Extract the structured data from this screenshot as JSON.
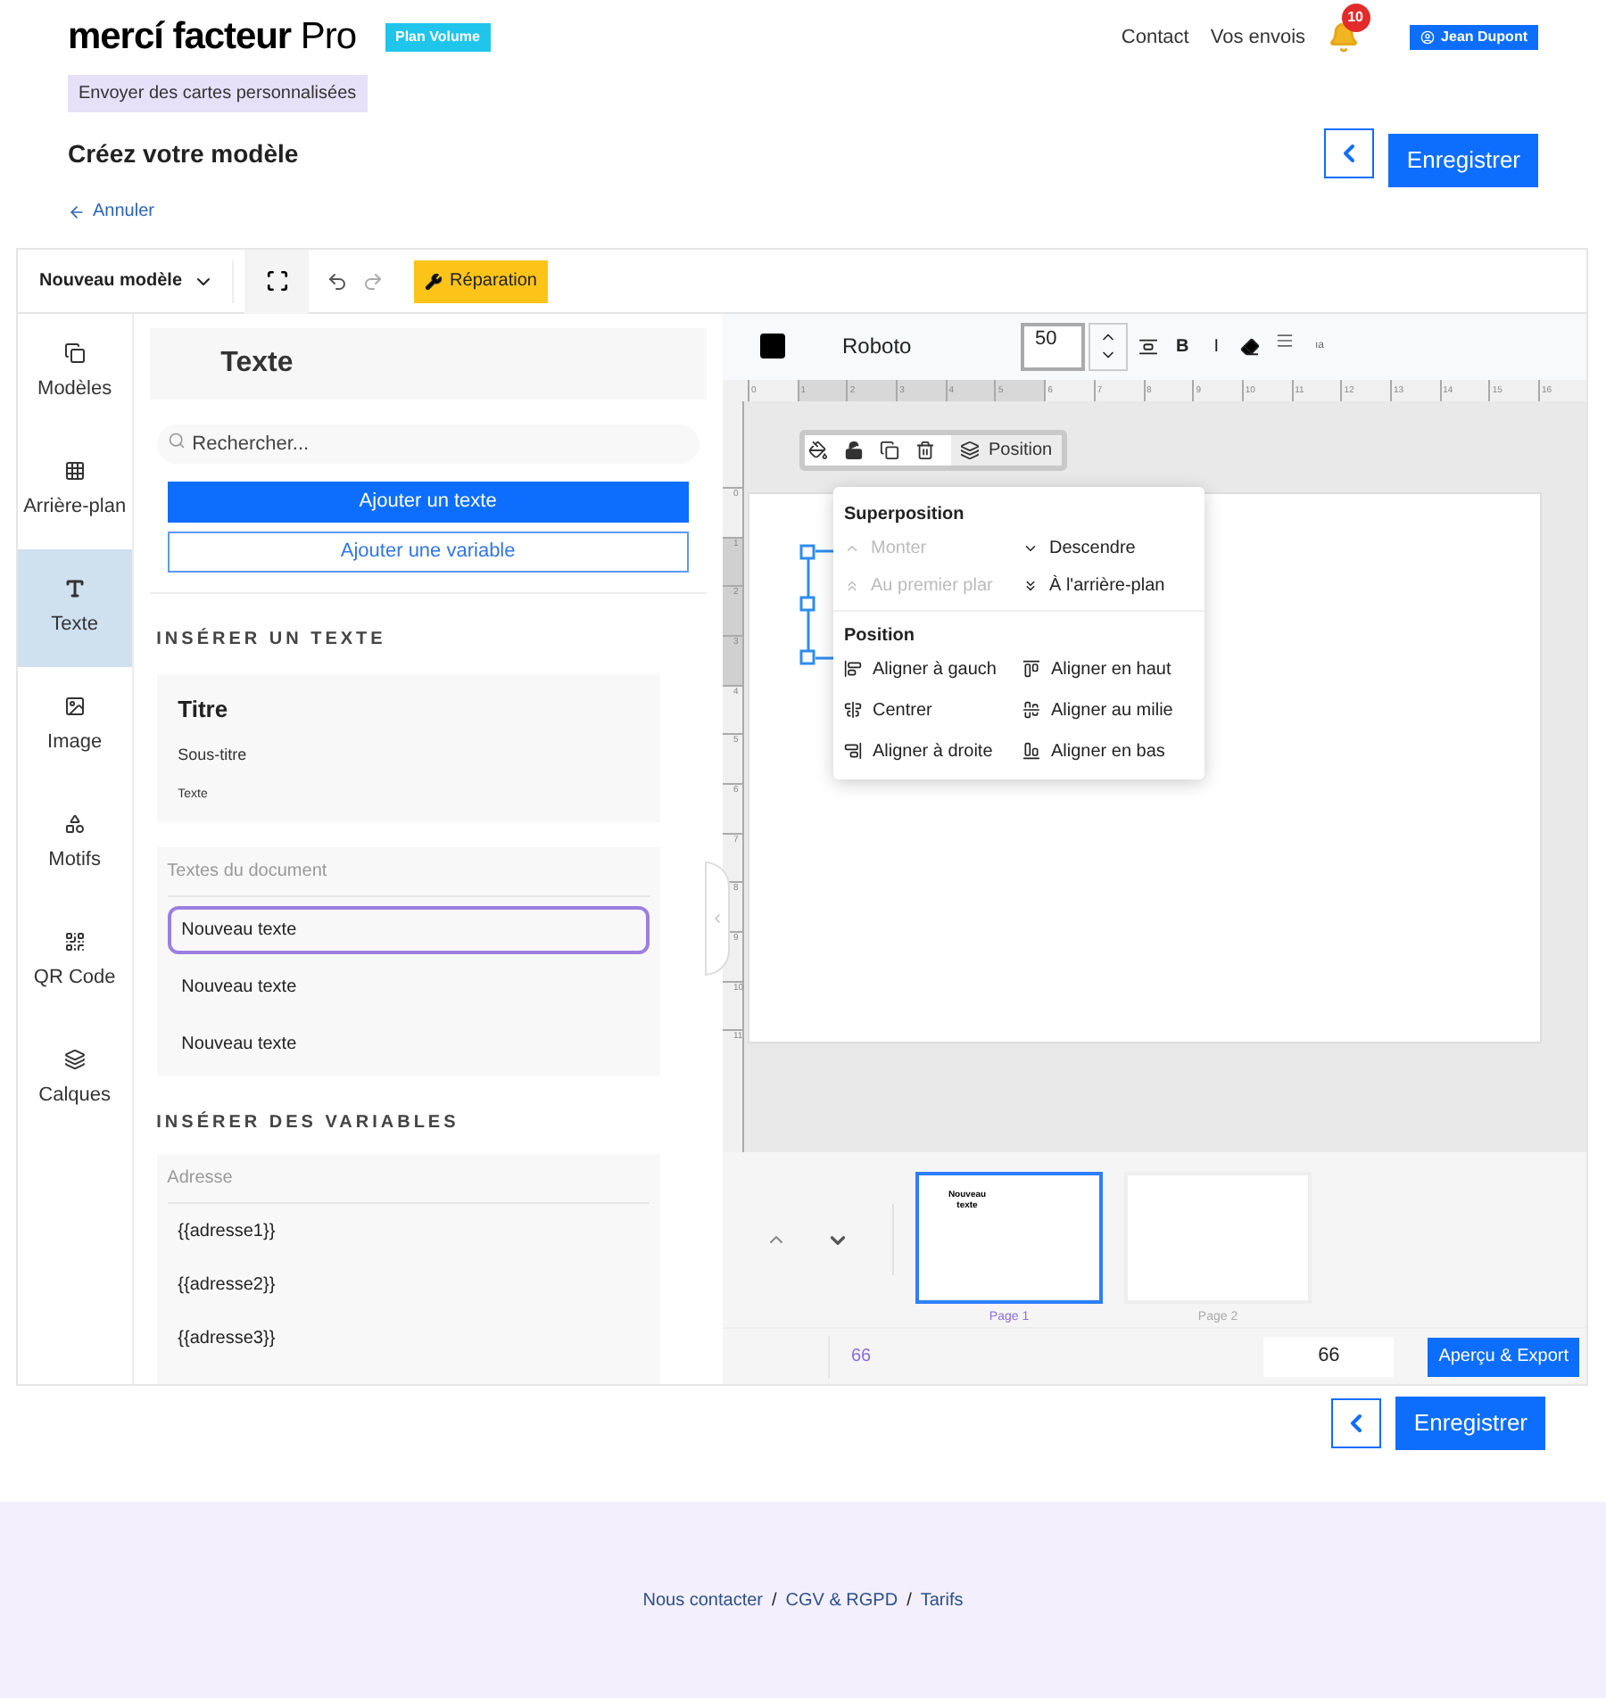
{
  "header": {
    "logo": "**mercí facteur** Pro",
    "plan_badge": "Plan Volume",
    "nav": [
      "Contact",
      "Vos envois"
    ],
    "notifications": "10",
    "user": "Jean Dupont"
  },
  "page": {
    "breadcrumb": "Envoyer des cartes personnalisées",
    "title": "Créez votre modèle",
    "save": "Enregistrer",
    "cancel": "Annuler"
  },
  "toolbar": {
    "template": "Nouveau modèle",
    "repair": "Réparation"
  },
  "rail": [
    {
      "label": "Modèles",
      "selected": false
    },
    {
      "label": "Arrière-plan",
      "selected": false
    },
    {
      "label": "Texte",
      "selected": true
    },
    {
      "label": "Image",
      "selected": false
    },
    {
      "label": "Motifs",
      "selected": false
    },
    {
      "label": "QR Code",
      "selected": false
    },
    {
      "label": "Calques",
      "selected": false
    }
  ],
  "panel": {
    "title": "Texte",
    "search": {
      "placeholder": "Rechercher..."
    },
    "add_text": "Ajouter un texte",
    "add_variable": "Ajouter une variable",
    "insert_heading": "INSÉRER UN TEXTE",
    "presets": [
      {
        "label": "Titre",
        "kind": "title"
      },
      {
        "label": "Sous-titre",
        "kind": "subtitle"
      },
      {
        "label": "Texte",
        "kind": "body"
      }
    ],
    "document_heading": "Textes du document",
    "document_texts": [
      {
        "label": "Nouveau texte",
        "selected": true
      },
      {
        "label": "Nouveau texte",
        "selected": false
      },
      {
        "label": "Nouveau texte",
        "selected": false
      }
    ],
    "variables_heading": "INSÉRER DES VARIABLES",
    "variable_group": "Adresse",
    "variables": [
      "{{adresse1}}",
      "{{adresse2}}",
      "{{adresse3}}"
    ]
  },
  "text_toolbar": {
    "color": "#000000",
    "font": "Roboto",
    "size": "50",
    "bold": "B",
    "italic": "I",
    "spacing": "ıa"
  },
  "ruler": {
    "horizontal": [
      "0",
      "1",
      "2",
      "3",
      "4",
      "5",
      "6",
      "7",
      "8",
      "9",
      "10",
      "11",
      "12",
      "13",
      "14",
      "15",
      "16"
    ],
    "vertical": [
      "0",
      "1",
      "2",
      "3",
      "4",
      "5",
      "6",
      "7",
      "8",
      "9",
      "10",
      "11"
    ]
  },
  "element_toolbar": {
    "position": "Position"
  },
  "position_menu": {
    "layer_heading": "Superposition",
    "layer_items": [
      {
        "label": "Monter",
        "disabled": true
      },
      {
        "label": "Descendre",
        "disabled": false
      },
      {
        "label": "Au premier plar",
        "disabled": true
      },
      {
        "label": "À l'arrière-plan",
        "disabled": false
      }
    ],
    "align_heading": "Position",
    "align_items": [
      "Aligner à gauch",
      "Aligner en haut",
      "Centrer",
      "Aligner au milie",
      "Aligner à droite",
      "Aligner en bas"
    ]
  },
  "pages": [
    {
      "label": "Page 1",
      "selected": true,
      "content": "Nouveau texte"
    },
    {
      "label": "Page 2",
      "selected": false
    }
  ],
  "bottom_bar": {
    "count": "66",
    "value": "66",
    "export": "Aperçu & Export"
  },
  "footer_save": "Enregistrer",
  "footer": {
    "links": [
      "Nous contacter",
      "CGV & RGPD",
      "Tarifs"
    ],
    "separator": "/"
  }
}
